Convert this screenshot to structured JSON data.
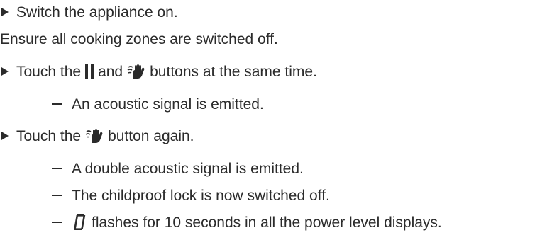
{
  "steps": [
    {
      "text": "Switch the appliance on."
    },
    {
      "text": "Ensure all cooking zones are switched off."
    },
    {
      "before": "Touch the",
      "middle": "and",
      "after": "buttons at the same time."
    },
    {
      "text": "An acoustic signal is emitted."
    },
    {
      "before": "Touch the",
      "after": "button again."
    },
    {
      "text": "A double acoustic signal is emitted."
    },
    {
      "text": "The childproof lock is now switched off."
    },
    {
      "text": "flashes for 10 seconds in all the power level displays."
    }
  ],
  "icons": {
    "pause": "pause-icon",
    "childlock": "childproof-lock-icon",
    "display_digit": "seven-segment-zero-icon"
  },
  "colors": {
    "text": "#2b2b2b"
  }
}
